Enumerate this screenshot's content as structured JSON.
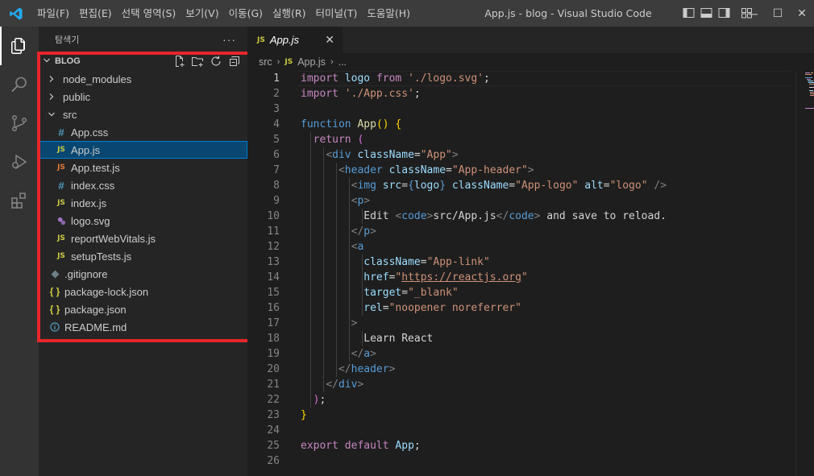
{
  "titlebar": {
    "menus": [
      "파일(F)",
      "편집(E)",
      "선택 영역(S)",
      "보기(V)",
      "이동(G)",
      "실행(R)",
      "터미널(T)",
      "도움말(H)"
    ],
    "window_title": "App.js - blog - Visual Studio Code",
    "controls": [
      "─",
      "☐",
      "✕"
    ]
  },
  "activity": [
    "explorer-icon",
    "search-icon",
    "source-control-icon",
    "run-debug-icon",
    "extensions-icon"
  ],
  "sidebar": {
    "title": "탐색기",
    "more": "···",
    "section": "BLOG",
    "items": [
      {
        "label": "node_modules",
        "type": "folder",
        "expanded": false,
        "depth": 0
      },
      {
        "label": "public",
        "type": "folder",
        "expanded": false,
        "depth": 0
      },
      {
        "label": "src",
        "type": "folder",
        "expanded": true,
        "depth": 0
      },
      {
        "label": "App.css",
        "type": "css",
        "depth": 1
      },
      {
        "label": "App.js",
        "type": "js",
        "depth": 1,
        "selected": true
      },
      {
        "label": "App.test.js",
        "type": "js-test",
        "depth": 1
      },
      {
        "label": "index.css",
        "type": "css",
        "depth": 1
      },
      {
        "label": "index.js",
        "type": "js",
        "depth": 1
      },
      {
        "label": "logo.svg",
        "type": "svg",
        "depth": 1
      },
      {
        "label": "reportWebVitals.js",
        "type": "js",
        "depth": 1
      },
      {
        "label": "setupTests.js",
        "type": "js",
        "depth": 1
      },
      {
        "label": ".gitignore",
        "type": "git",
        "depth": 0
      },
      {
        "label": "package-lock.json",
        "type": "json",
        "depth": 0
      },
      {
        "label": "package.json",
        "type": "json",
        "depth": 0
      },
      {
        "label": "README.md",
        "type": "info",
        "depth": 0
      }
    ]
  },
  "editor": {
    "tab": {
      "icon": "JS",
      "label": "App.js",
      "close": "✕"
    },
    "breadcrumbs": [
      "src",
      "App.js",
      "..."
    ],
    "current_line": 1,
    "lines": [
      [
        [
          "kw",
          "import"
        ],
        [
          "tx",
          " "
        ],
        [
          "var",
          "logo"
        ],
        [
          "tx",
          " "
        ],
        [
          "kw",
          "from"
        ],
        [
          "tx",
          " "
        ],
        [
          "str",
          "'./logo.svg'"
        ],
        [
          "tx",
          ";"
        ]
      ],
      [
        [
          "kw",
          "import"
        ],
        [
          "tx",
          " "
        ],
        [
          "str",
          "'./App.css'"
        ],
        [
          "tx",
          ";"
        ]
      ],
      [],
      [
        [
          "kb",
          "function"
        ],
        [
          "tx",
          " "
        ],
        [
          "fn",
          "App"
        ],
        [
          "yl",
          "()"
        ],
        [
          "tx",
          " "
        ],
        [
          "yl",
          "{"
        ]
      ],
      [
        [
          "tx",
          "  "
        ],
        [
          "kw",
          "return"
        ],
        [
          "tx",
          " "
        ],
        [
          "pu",
          "("
        ]
      ],
      [
        [
          "tx",
          "    "
        ],
        [
          "br",
          "<"
        ],
        [
          "tag",
          "div"
        ],
        [
          "tx",
          " "
        ],
        [
          "var",
          "className"
        ],
        [
          "tx",
          "="
        ],
        [
          "str",
          "\"App\""
        ],
        [
          "br",
          ">"
        ]
      ],
      [
        [
          "tx",
          "      "
        ],
        [
          "br",
          "<"
        ],
        [
          "tag",
          "header"
        ],
        [
          "tx",
          " "
        ],
        [
          "var",
          "className"
        ],
        [
          "tx",
          "="
        ],
        [
          "str",
          "\"App-header\""
        ],
        [
          "br",
          ">"
        ]
      ],
      [
        [
          "tx",
          "        "
        ],
        [
          "br",
          "<"
        ],
        [
          "tag",
          "img"
        ],
        [
          "tx",
          " "
        ],
        [
          "var",
          "src"
        ],
        [
          "tx",
          "="
        ],
        [
          "kb",
          "{"
        ],
        [
          "var",
          "logo"
        ],
        [
          "kb",
          "}"
        ],
        [
          "tx",
          " "
        ],
        [
          "var",
          "className"
        ],
        [
          "tx",
          "="
        ],
        [
          "str",
          "\"App-logo\""
        ],
        [
          "tx",
          " "
        ],
        [
          "var",
          "alt"
        ],
        [
          "tx",
          "="
        ],
        [
          "str",
          "\"logo\""
        ],
        [
          "tx",
          " "
        ],
        [
          "br",
          "/>"
        ]
      ],
      [
        [
          "tx",
          "        "
        ],
        [
          "br",
          "<"
        ],
        [
          "tag",
          "p"
        ],
        [
          "br",
          ">"
        ]
      ],
      [
        [
          "tx",
          "          Edit "
        ],
        [
          "br",
          "<"
        ],
        [
          "tag",
          "code"
        ],
        [
          "br",
          ">"
        ],
        [
          "tx",
          "src/App.js"
        ],
        [
          "br",
          "</"
        ],
        [
          "tag",
          "code"
        ],
        [
          "br",
          ">"
        ],
        [
          "tx",
          " and save to reload."
        ]
      ],
      [
        [
          "tx",
          "        "
        ],
        [
          "br",
          "</"
        ],
        [
          "tag",
          "p"
        ],
        [
          "br",
          ">"
        ]
      ],
      [
        [
          "tx",
          "        "
        ],
        [
          "br",
          "<"
        ],
        [
          "tag",
          "a"
        ]
      ],
      [
        [
          "tx",
          "          "
        ],
        [
          "var",
          "className"
        ],
        [
          "tx",
          "="
        ],
        [
          "str",
          "\"App-link\""
        ]
      ],
      [
        [
          "tx",
          "          "
        ],
        [
          "var",
          "href"
        ],
        [
          "tx",
          "="
        ],
        [
          "str",
          "\""
        ],
        [
          "stru",
          "https://reactjs.org"
        ],
        [
          "str",
          "\""
        ]
      ],
      [
        [
          "tx",
          "          "
        ],
        [
          "var",
          "target"
        ],
        [
          "tx",
          "="
        ],
        [
          "str",
          "\"_blank\""
        ]
      ],
      [
        [
          "tx",
          "          "
        ],
        [
          "var",
          "rel"
        ],
        [
          "tx",
          "="
        ],
        [
          "str",
          "\"noopener noreferrer\""
        ]
      ],
      [
        [
          "tx",
          "        "
        ],
        [
          "br",
          ">"
        ]
      ],
      [
        [
          "tx",
          "          Learn React"
        ]
      ],
      [
        [
          "tx",
          "        "
        ],
        [
          "br",
          "</"
        ],
        [
          "tag",
          "a"
        ],
        [
          "br",
          ">"
        ]
      ],
      [
        [
          "tx",
          "      "
        ],
        [
          "br",
          "</"
        ],
        [
          "tag",
          "header"
        ],
        [
          "br",
          ">"
        ]
      ],
      [
        [
          "tx",
          "    "
        ],
        [
          "br",
          "</"
        ],
        [
          "tag",
          "div"
        ],
        [
          "br",
          ">"
        ]
      ],
      [
        [
          "tx",
          "  "
        ],
        [
          "pu",
          ")"
        ],
        [
          "tx",
          ";"
        ]
      ],
      [
        [
          "yl",
          "}"
        ]
      ],
      [],
      [
        [
          "kw",
          "export"
        ],
        [
          "tx",
          " "
        ],
        [
          "kw",
          "default"
        ],
        [
          "tx",
          " "
        ],
        [
          "var",
          "App"
        ],
        [
          "tx",
          ";"
        ]
      ],
      []
    ]
  },
  "colors": {
    "accent": "#007acc",
    "selection": "#094771",
    "highlight_border": "#e8262b"
  }
}
